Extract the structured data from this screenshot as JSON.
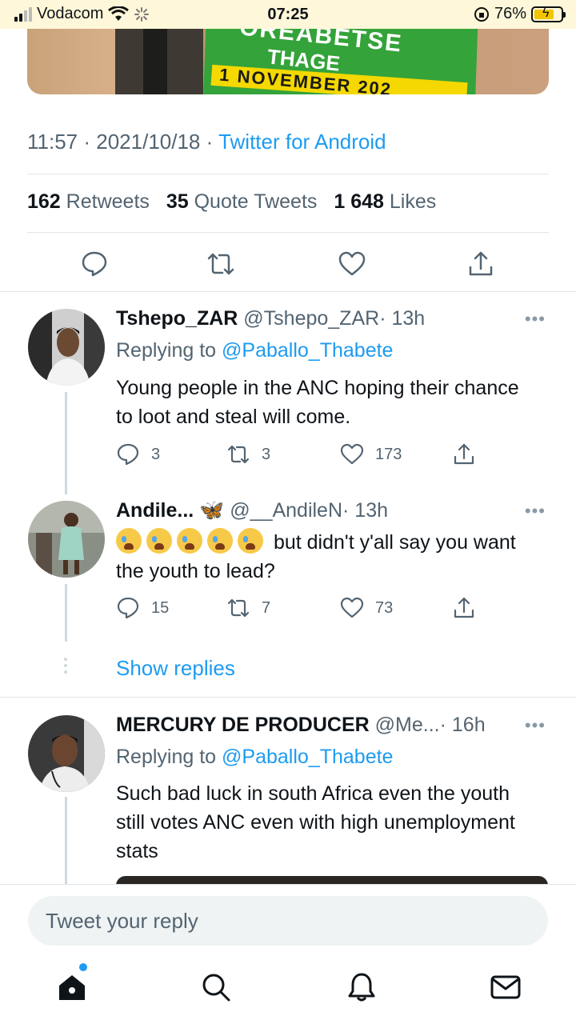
{
  "status_bar": {
    "carrier": "Vodacom",
    "time": "07:25",
    "battery_percent": "76%"
  },
  "top_image": {
    "poster_line1": "OREABETSE",
    "poster_line2": "THAGE",
    "poster_line3": "1 NOVEMBER 202"
  },
  "tweet_meta": {
    "time": "11:57",
    "date": "2021/10/18",
    "source": "Twitter for Android"
  },
  "tweet_stats": {
    "retweets_count": "162",
    "retweets_label": "Retweets",
    "quotes_count": "35",
    "quotes_label": "Quote Tweets",
    "likes_count": "1 648",
    "likes_label": "Likes"
  },
  "replies": [
    {
      "name": "Tshepo_ZAR",
      "handle": "@Tshepo_ZAR",
      "time": "· 13h",
      "replying_prefix": "Replying to ",
      "replying_to": "@Paballo_Thabete",
      "text": "Young people in the ANC hoping their chance to loot and steal will come.",
      "reply_count": "3",
      "retweet_count": "3",
      "like_count": "173"
    },
    {
      "name": "Andile...",
      "name_emoji": "🦋",
      "handle": "@__AndileN",
      "time": "· 13h",
      "text": "but didn't y'all say you want the youth to lead?",
      "reply_count": "15",
      "retweet_count": "7",
      "like_count": "73"
    },
    {
      "name": "MERCURY DE PRODUCER",
      "handle": "@Me...",
      "time": "· 16h",
      "replying_prefix": "Replying to ",
      "replying_to": "@Paballo_Thabete",
      "text": "Such bad luck in south Africa even the youth still votes ANC even with high unemployment stats"
    }
  ],
  "show_replies": "Show replies",
  "reply_box": {
    "placeholder": "Tweet your reply"
  },
  "colors": {
    "accent": "#1d9bf0",
    "muted_text": "#536471",
    "status_bar_bg": "#fff7d9"
  },
  "icons": {
    "reply": "reply-icon",
    "retweet": "retweet-icon",
    "like": "heart-icon",
    "share": "share-icon",
    "home": "home-icon",
    "search": "search-icon",
    "notifications": "bell-icon",
    "messages": "mail-icon"
  }
}
